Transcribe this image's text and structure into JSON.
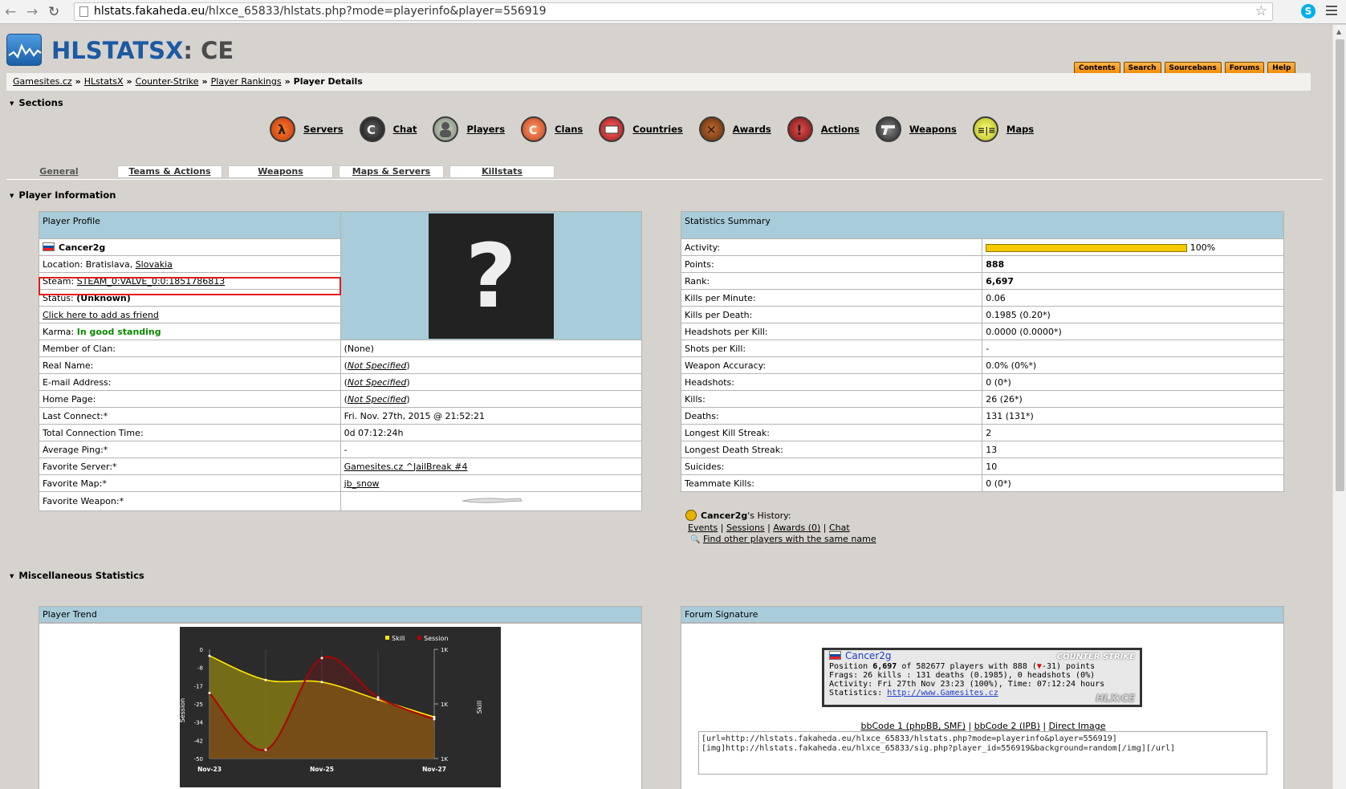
{
  "browser": {
    "url_host": "hlstats.fakaheda.eu",
    "url_path": "/hlxce_65833/hlstats.php?mode=playerinfo&player=556919"
  },
  "header": {
    "logo_main": "HLSTATSX",
    "logo_suffix": ": CE",
    "menu": [
      "Contents",
      "Search",
      "Sourcebans",
      "Forums",
      "Help"
    ]
  },
  "breadcrumb": {
    "items": [
      "Gamesites.cz",
      "HLstatsX",
      "Counter-Strike",
      "Player Rankings"
    ],
    "current": "Player Details",
    "separator": "»"
  },
  "sections": {
    "title": "Sections",
    "items": [
      "Servers",
      "Chat",
      "Players",
      "Clans",
      "Countries",
      "Awards",
      "Actions",
      "Weapons",
      "Maps"
    ]
  },
  "tabs": [
    "General",
    "Teams & Actions",
    "Weapons",
    "Maps & Servers",
    "Killstats"
  ],
  "player_info_title": "Player Information",
  "profile": {
    "header": "Player Profile",
    "name": "Cancer2g",
    "location_label": "Location:",
    "location_city": "Bratislava,",
    "location_country": "Slovakia",
    "steam_label": "Steam:",
    "steam_id": "STEAM_0:VALVE_0:0:1851786813",
    "status_label": "Status:",
    "status_value": "(Unknown)",
    "friend_link": "Click here to add as friend",
    "karma_label": "Karma:",
    "karma_value": "In good standing",
    "avatar_glyph": "?",
    "rows": [
      {
        "label": "Member of Clan:",
        "value": "(None)",
        "style": "plain"
      },
      {
        "label": "Real Name:",
        "value": "Not Specified",
        "style": "paren"
      },
      {
        "label": "E-mail Address:",
        "value": "Not Specified",
        "style": "paren"
      },
      {
        "label": "Home Page:",
        "value": "Not Specified",
        "style": "paren"
      },
      {
        "label": "Last Connect:*",
        "value": "Fri. Nov. 27th, 2015 @ 21:52:21",
        "style": "plain"
      },
      {
        "label": "Total Connection Time:",
        "value": "0d 07:12:24h",
        "style": "plain"
      },
      {
        "label": "Average Ping:*",
        "value": "-",
        "style": "plain"
      },
      {
        "label": "Favorite Server:*",
        "value": "Gamesites.cz ^JailBreak #4",
        "style": "link"
      },
      {
        "label": "Favorite Map:*",
        "value": "jb_snow",
        "style": "link"
      },
      {
        "label": "Favorite Weapon:*",
        "value": "",
        "style": "weapon"
      }
    ]
  },
  "summary": {
    "header": "Statistics Summary",
    "activity_label": "Activity:",
    "activity_pct": 100,
    "activity_text": "100%",
    "rows": [
      {
        "label": "Points:",
        "value": "888",
        "bold": true
      },
      {
        "label": "Rank:",
        "value": "6,697",
        "bold": true
      },
      {
        "label": "Kills per Minute:",
        "value": "0.06"
      },
      {
        "label": "Kills per Death:",
        "value": "0.1985 (0.20*)"
      },
      {
        "label": "Headshots per Kill:",
        "value": "0.0000 (0.0000*)"
      },
      {
        "label": "Shots per Kill:",
        "value": "-"
      },
      {
        "label": "Weapon Accuracy:",
        "value": "0.0% (0%*)"
      },
      {
        "label": "Headshots:",
        "value": "0 (0*)"
      },
      {
        "label": "Kills:",
        "value": "26 (26*)"
      },
      {
        "label": "Deaths:",
        "value": "131 (131*)"
      },
      {
        "label": "Longest Kill Streak:",
        "value": "2"
      },
      {
        "label": "Longest Death Streak:",
        "value": "13"
      },
      {
        "label": "Suicides:",
        "value": "10"
      },
      {
        "label": "Teammate Kills:",
        "value": "0 (0*)"
      }
    ]
  },
  "history": {
    "name": "Cancer2g",
    "suffix": "'s History:",
    "links": [
      "Events",
      "Sessions",
      "Awards (0)",
      "Chat"
    ],
    "find_link": "Find other players with the same name"
  },
  "misc_title": "Miscellaneous Statistics",
  "trend": {
    "header": "Player Trend"
  },
  "chart_data": {
    "type": "line",
    "title": "",
    "xlabel": "",
    "ylabel": "Session",
    "y2label": "Skill",
    "x": [
      "Nov-23",
      "Nov-24",
      "Nov-25",
      "Nov-26",
      "Nov-27"
    ],
    "x_tick_labels": [
      "Nov-23",
      "Nov-25",
      "Nov-27"
    ],
    "y_ticks": [
      "0",
      "-8",
      "-17",
      "-25",
      "-34",
      "-42",
      "-50"
    ],
    "y2_ticks": [
      "1K",
      "1K",
      "1K"
    ],
    "ylim": [
      -50,
      0
    ],
    "series": [
      {
        "name": "Skill",
        "color": "#ffe600",
        "values": [
          -3,
          -14,
          -15,
          -23,
          -31
        ]
      },
      {
        "name": "Session",
        "color": "#b00000",
        "values": [
          -20,
          -46,
          -4,
          -22,
          -32
        ]
      }
    ],
    "legend_position": "top-right",
    "grid": true
  },
  "signature": {
    "header": "Forum Signature",
    "name": "Cancer2g",
    "line1_pre": "Position ",
    "line1_rank": "6,697",
    "line1_post": " of 582677 players with 888 (",
    "line1_change": "-31",
    "line1_end": ") points",
    "line2": "Frags: 26 kills : 131 deaths (0.1985), 0 headshots (0%)",
    "line3": "Activity: Fri 27th Nov 23:23 (100%), Time: 07:12:24 hours",
    "line4_label": "Statistics: ",
    "line4_link": "http://www.Gamesites.cz",
    "cs_logo": "COUNTER STRIKE",
    "hlx_logo": "HLX:CE",
    "links": [
      "bbCode 1 (phpBB, SMF)",
      "bbCode 2 (IPB)",
      "Direct Image"
    ],
    "code": "[url=http://hlstats.fakaheda.eu/hlxce_65833/hlstats.php?mode=playerinfo&player=556919]\n[img]http://hlstats.fakaheda.eu/hlxce_65833/sig.php?player_id=556919&background=random[/img][/url]"
  }
}
